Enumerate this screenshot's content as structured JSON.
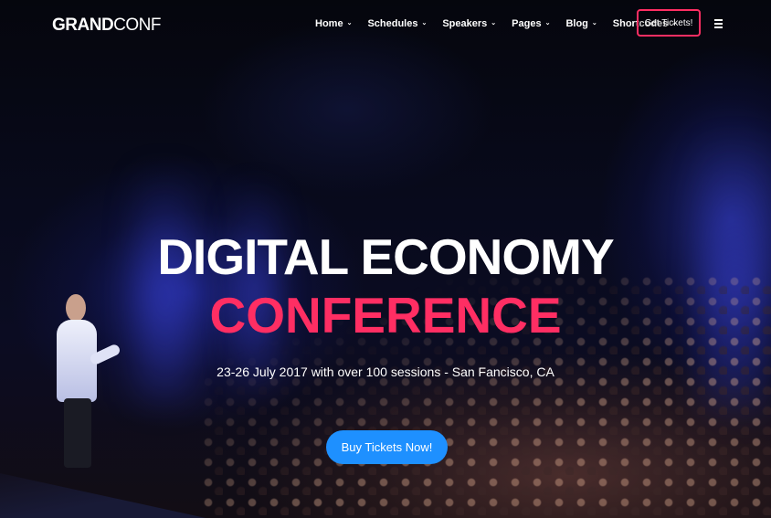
{
  "brand": {
    "bold": "GRAND",
    "light": "CONF"
  },
  "nav": {
    "items": [
      {
        "label": "Home",
        "icon": "chevron-down-icon"
      },
      {
        "label": "Schedules",
        "icon": "chevron-down-icon"
      },
      {
        "label": "Speakers",
        "icon": "chevron-down-icon"
      },
      {
        "label": "Pages",
        "icon": "chevron-down-icon"
      },
      {
        "label": "Blog",
        "icon": "chevron-down-icon"
      },
      {
        "label": "Shortcodes",
        "icon": "chevron-down-icon"
      }
    ],
    "cta_label": "Get Tickets!",
    "menu_icon": "hamburger-menu-icon"
  },
  "hero": {
    "title": "DIGITAL ECONOMY",
    "subtitle": "CONFERENCE",
    "description": "23-26 July 2017 with over 100 sessions - San Fancisco, CA",
    "button_label": "Buy Tickets Now!"
  },
  "colors": {
    "accent": "#ff2e63",
    "button": "#1e90ff",
    "text": "#ffffff"
  }
}
